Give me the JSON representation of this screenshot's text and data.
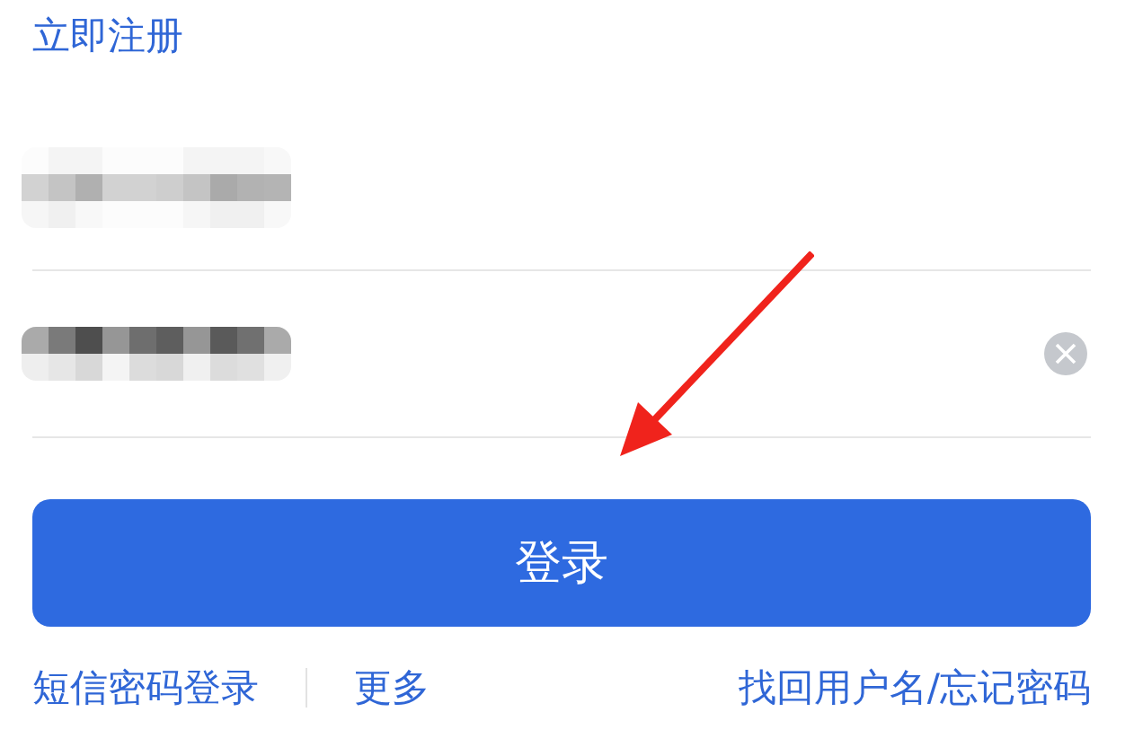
{
  "register_link": "立即注册",
  "fields": [
    {
      "kind": "username",
      "clear_button": false
    },
    {
      "kind": "password",
      "clear_button": true
    }
  ],
  "annotation": {
    "kind": "arrow",
    "color": "#f0231c"
  },
  "login_button": "登录",
  "left_links": [
    "短信密码登录",
    "更多"
  ],
  "right_link": "找回用户名/忘记密码"
}
